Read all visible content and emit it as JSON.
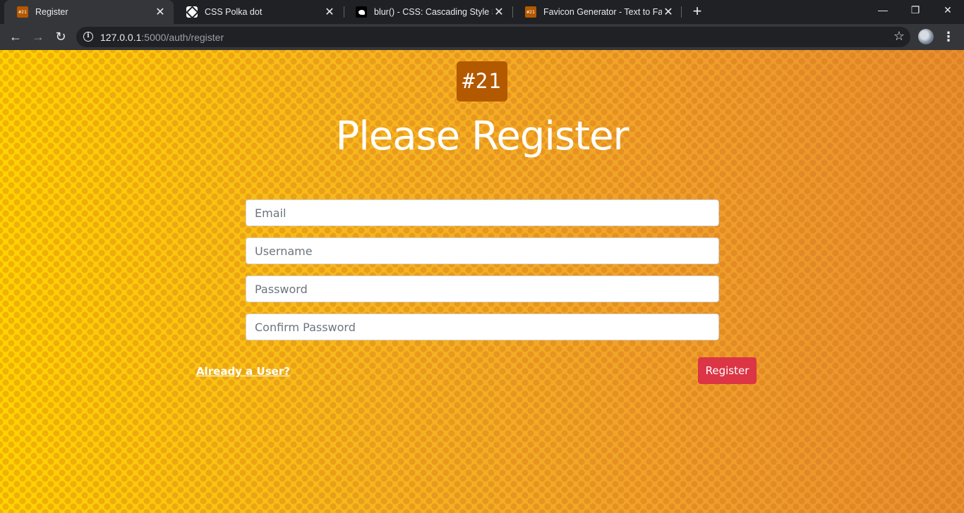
{
  "browser": {
    "tabs": [
      {
        "label": "Register",
        "favicon": "#21",
        "active": true
      },
      {
        "label": "CSS Polka dot",
        "favicon": "polka-icon"
      },
      {
        "label": "blur() - CSS: Cascading Style Shee",
        "favicon": "mdn-icon"
      },
      {
        "label": "Favicon Generator - Text to Favic",
        "favicon": "#21"
      }
    ],
    "new_tab": "+",
    "window_controls": {
      "minimize": "—",
      "restore": "❐",
      "close": "✕"
    },
    "nav": {
      "back": "←",
      "forward": "→",
      "reload": "↻",
      "menu": "⋮"
    },
    "address": {
      "host": "127.0.0.1",
      "path": ":5000/auth/register"
    }
  },
  "page": {
    "logo_text": "#21",
    "title": "Please Register",
    "form": {
      "email_placeholder": "Email",
      "username_placeholder": "Username",
      "password_placeholder": "Password",
      "confirm_placeholder": "Confirm Password"
    },
    "login_link": "Already a User?",
    "submit_label": "Register"
  },
  "colors": {
    "accent_brown": "#b35900",
    "button_red": "#dc3545",
    "background_yellow": "#ffd400",
    "background_orange": "#e8902e"
  }
}
